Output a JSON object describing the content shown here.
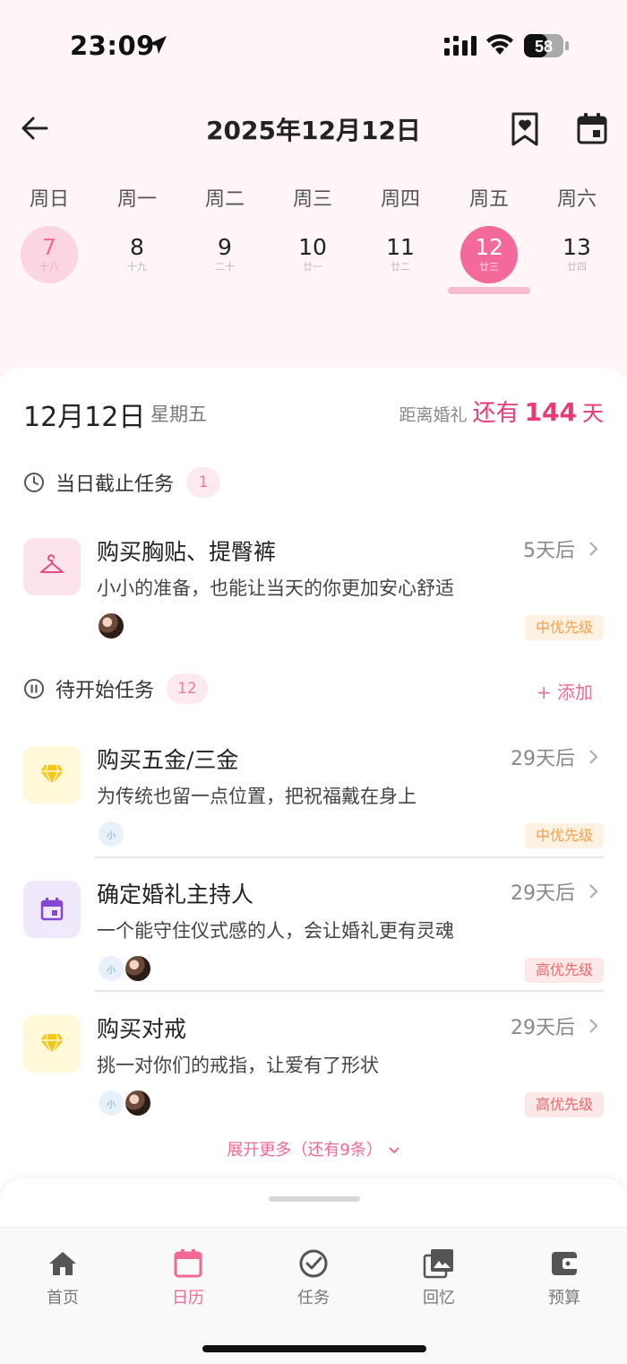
{
  "status_bar": {
    "time": "23:09",
    "battery": "58"
  },
  "header": {
    "title": "2025年12月12日"
  },
  "week": [
    {
      "weekday": "周日",
      "day": "7",
      "lunar": "十八",
      "state": "past"
    },
    {
      "weekday": "周一",
      "day": "8",
      "lunar": "十九",
      "state": "normal"
    },
    {
      "weekday": "周二",
      "day": "9",
      "lunar": "二十",
      "state": "normal"
    },
    {
      "weekday": "周三",
      "day": "10",
      "lunar": "廿一",
      "state": "normal"
    },
    {
      "weekday": "周四",
      "day": "11",
      "lunar": "廿二",
      "state": "normal"
    },
    {
      "weekday": "周五",
      "day": "12",
      "lunar": "廿三",
      "state": "selected"
    },
    {
      "weekday": "周六",
      "day": "13",
      "lunar": "廿四",
      "state": "normal"
    }
  ],
  "summary": {
    "date": "12月12日",
    "weekday": "星期五",
    "countdown_prefix": "距离婚礼",
    "countdown_still": "还有",
    "countdown_days": "144",
    "countdown_unit": "天"
  },
  "due_section": {
    "label": "当日截止任务",
    "count": "1"
  },
  "due_tasks": [
    {
      "title": "购买胸贴、提臀裤",
      "desc": "小小的准备，也能让当天的你更加安心舒适",
      "due": "5天后",
      "priority": "中优先级",
      "icon": "hanger-icon"
    }
  ],
  "pending_section": {
    "label": "待开始任务",
    "count": "12",
    "add": "+ 添加"
  },
  "pending_tasks": [
    {
      "title": "购买五金/三金",
      "desc": "为传统也留一点位置，把祝福戴在身上",
      "due": "29天后",
      "priority": "中优先级",
      "icon": "diamond-icon",
      "avatar_text": "小"
    },
    {
      "title": "确定婚礼主持人",
      "desc": "一个能守住仪式感的人，会让婚礼更有灵魂",
      "due": "29天后",
      "priority": "高优先级",
      "icon": "calendar-icon",
      "avatar_text": "小"
    },
    {
      "title": "购买对戒",
      "desc": "挑一对你们的戒指，让爱有了形状",
      "due": "29天后",
      "priority": "高优先级",
      "icon": "diamond-icon",
      "avatar_text": "小"
    }
  ],
  "expand_more": "展开更多（还有9条）",
  "tabs": [
    {
      "label": "首页",
      "icon": "home-icon"
    },
    {
      "label": "日历",
      "icon": "calendar-icon",
      "active": true
    },
    {
      "label": "任务",
      "icon": "check-circle-icon"
    },
    {
      "label": "回忆",
      "icon": "photos-icon"
    },
    {
      "label": "预算",
      "icon": "wallet-icon"
    }
  ],
  "colors": {
    "accent": "#f06a95",
    "pink_bg": "#fff5f7",
    "selected_day": "#f2699a"
  }
}
